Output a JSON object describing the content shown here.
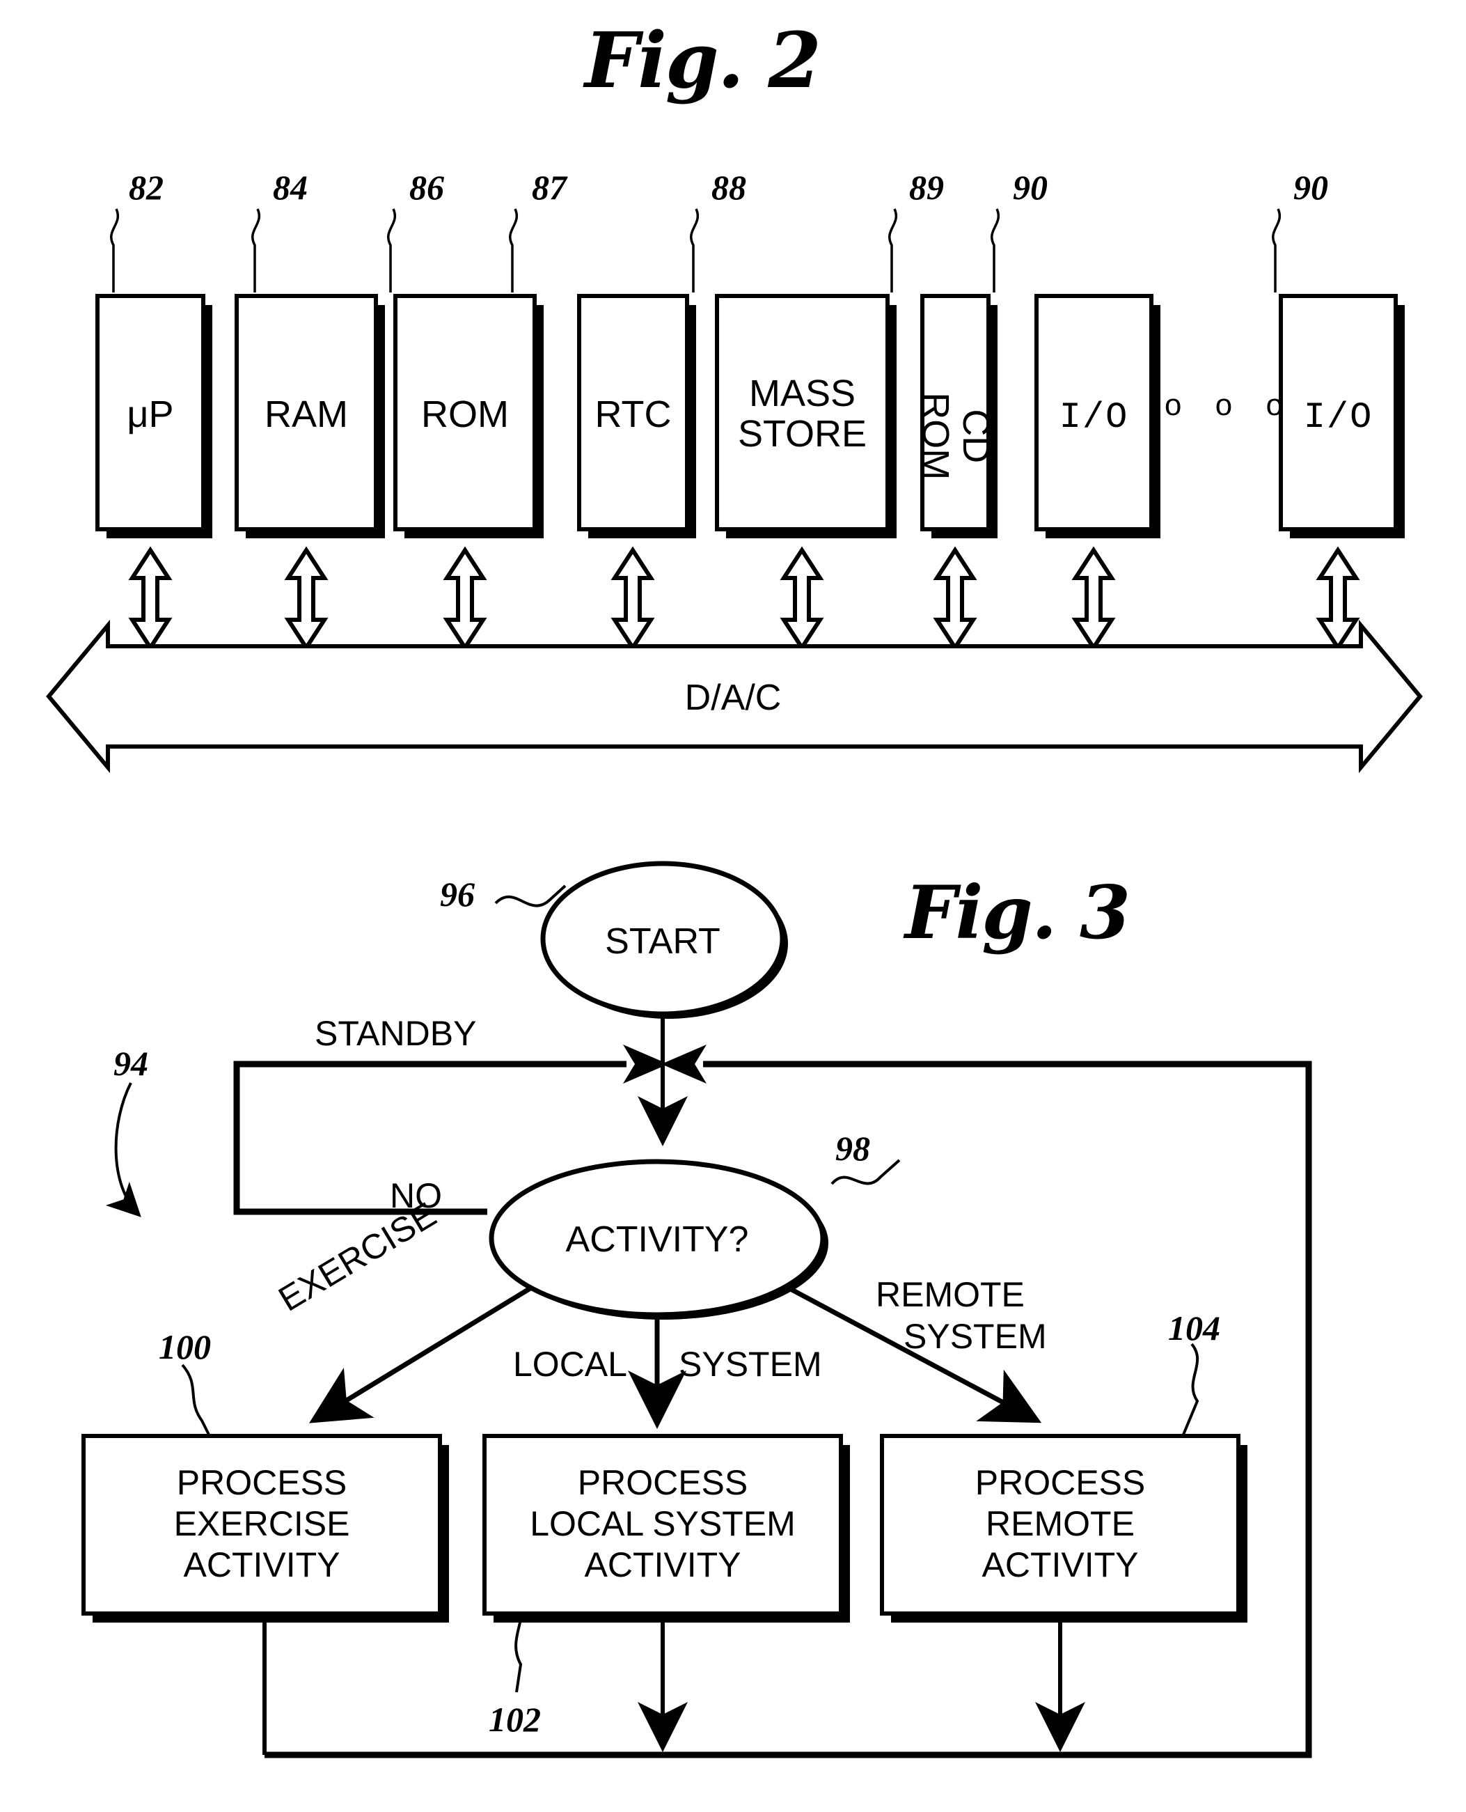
{
  "figures": [
    {
      "id": "fig2",
      "title": "Fig. 2",
      "bus_label": "D/A/C",
      "ellipsis": "o o o",
      "blocks": [
        {
          "ref": "82",
          "label": "μP",
          "orientation": "horizontal"
        },
        {
          "ref": "84",
          "label": "RAM",
          "orientation": "horizontal"
        },
        {
          "ref": "86",
          "label": "ROM",
          "orientation": "horizontal"
        },
        {
          "ref": "87",
          "label": "RTC",
          "orientation": "horizontal"
        },
        {
          "ref": "88",
          "label": "MASS\nSTORE",
          "orientation": "horizontal"
        },
        {
          "ref": "89",
          "label": "CD\nROM",
          "orientation": "vertical"
        },
        {
          "ref": "90",
          "label": "I/O",
          "orientation": "horizontal"
        },
        {
          "ref": "90",
          "label": "I/O",
          "orientation": "horizontal"
        }
      ]
    },
    {
      "id": "fig3",
      "title": "Fig. 3",
      "flowchart_ref": "94",
      "nodes": [
        {
          "ref": "96",
          "label": "START",
          "shape": "oval"
        },
        {
          "ref": "98",
          "label": "ACTIVITY?",
          "shape": "oval"
        },
        {
          "ref": "100",
          "label": "PROCESS\nEXERCISE\nACTIVITY",
          "shape": "box"
        },
        {
          "ref": "102",
          "label": "PROCESS\nLOCAL SYSTEM\nACTIVITY",
          "shape": "box"
        },
        {
          "ref": "104",
          "label": "PROCESS\nREMOTE\nACTIVITY",
          "shape": "box"
        }
      ],
      "edge_labels": {
        "standby": "STANDBY",
        "no": "NO",
        "exercise": "EXERCISE",
        "local_left": "LOCAL",
        "local_right": "SYSTEM",
        "remote_line1": "REMOTE",
        "remote_line2": "SYSTEM"
      }
    }
  ],
  "colors": {
    "ink": "#000000",
    "paper": "#ffffff"
  }
}
